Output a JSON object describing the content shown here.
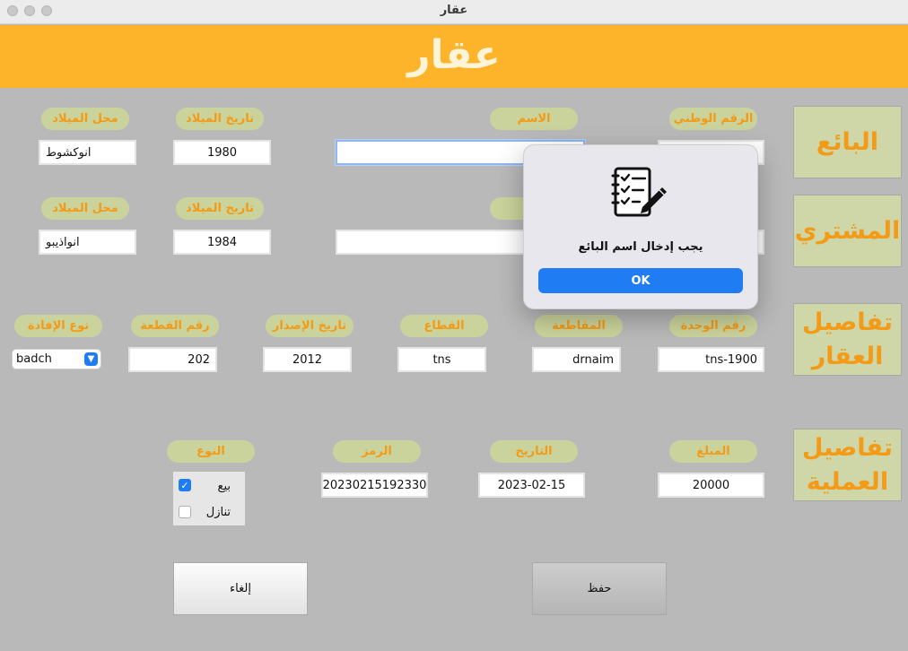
{
  "window": {
    "title": "عقار"
  },
  "banner": {
    "title": "عقار"
  },
  "sections": {
    "seller": "البائع",
    "buyer": "المشتري",
    "property": [
      "تفاصيل",
      "العقار"
    ],
    "transaction": [
      "تفاصيل",
      "العملية"
    ]
  },
  "seller": {
    "national_id_label": "الرقم الوطني",
    "name_label": "الاسم",
    "birth_date_label": "تاريخ الميلاد",
    "birth_place_label": "محل الميلاد",
    "national_id_value": "",
    "name_value": "",
    "birth_date_value": "1980",
    "birth_place_value": "انوكشوط"
  },
  "buyer": {
    "birth_date_label": "تاريخ الميلاد",
    "birth_place_label": "محل الميلاد",
    "name_value": "",
    "national_id_value": "",
    "birth_date_value": "1984",
    "birth_place_value": "انواذيبو"
  },
  "property": {
    "unit_number_label": "رقم الوحدة",
    "district_label": "المقاطعة",
    "sector_label": "القطاع",
    "issue_date_label": "تاريخ الإصدار",
    "plot_number_label": "رقم القطعة",
    "benefit_type_label": "نوع الإفادة",
    "unit_number_value": "tns-1900",
    "district_value": "drnaim",
    "sector_value": "tns",
    "issue_date_value": "2012",
    "plot_number_value": "202",
    "benefit_type_value": "badch"
  },
  "transaction": {
    "amount_label": "المبلغ",
    "date_label": "التاريخ",
    "code_label": "الرمز",
    "type_label": "النوع",
    "amount_value": "20000",
    "date_value": "2023-02-15",
    "code_value": "20230215192330",
    "type_options": [
      {
        "label": "بيع",
        "checked": true
      },
      {
        "label": "تنازل",
        "checked": false
      }
    ]
  },
  "buttons": {
    "cancel": "إلغاء",
    "save": "حفظ"
  },
  "dialog": {
    "icon": "notepad-checklist-icon",
    "message": "يجب إدخال اسم البائع",
    "ok": "OK"
  },
  "colors": {
    "banner": "#fdb42a",
    "accent_text": "#f39a17",
    "pill": "#cbd39c",
    "section_box": "#cfd6a7",
    "background": "#b9b9b9",
    "ok_button": "#1f7cf2"
  }
}
